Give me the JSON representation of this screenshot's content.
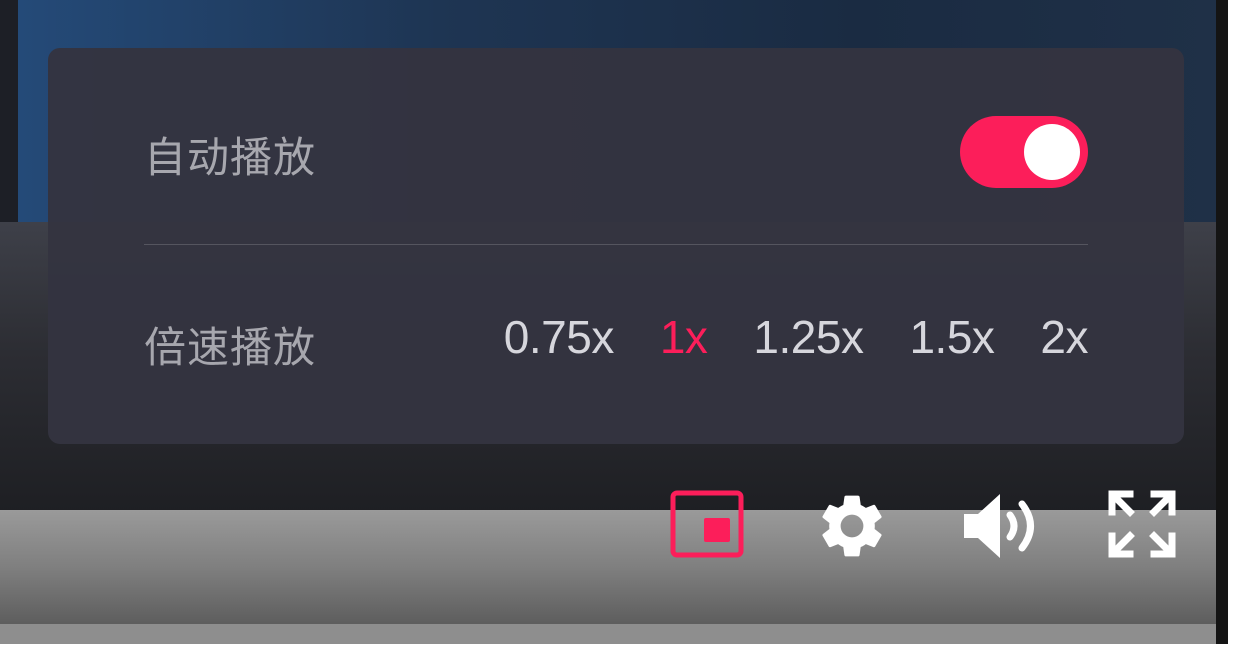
{
  "settings": {
    "autoplay_label": "自动播放",
    "autoplay_on": true,
    "speed_label": "倍速播放",
    "speed_options": [
      "0.75x",
      "1x",
      "1.25x",
      "1.5x",
      "2x"
    ],
    "speed_selected": "1x"
  },
  "controls": {
    "icons": [
      "picture-in-picture-icon",
      "gear-icon",
      "volume-icon",
      "fullscreen-icon"
    ]
  },
  "colors": {
    "accent": "#fc1e5a",
    "panel_bg": "#343440",
    "label_text": "#a7a7ae",
    "option_text": "#d6d6dc"
  }
}
